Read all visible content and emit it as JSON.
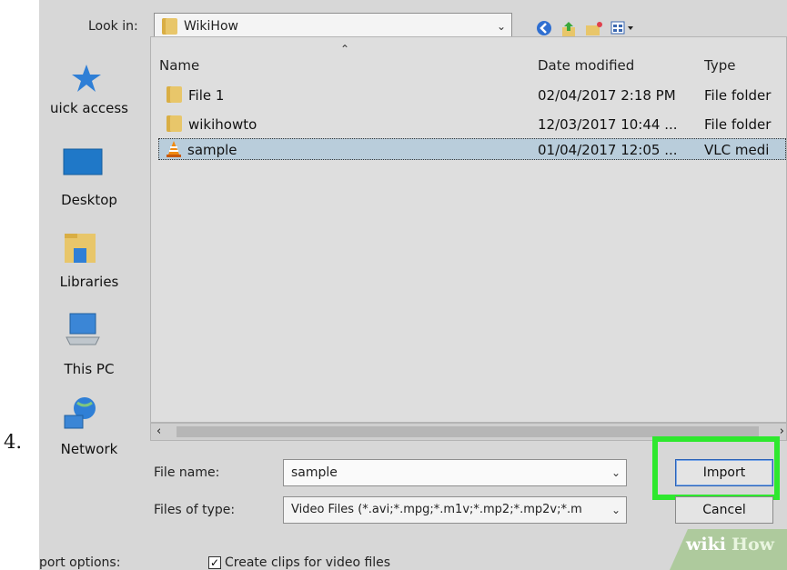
{
  "step_number": "4.",
  "toolbar": {
    "look_in_label": "Look in:",
    "look_in_value": "WikiHow",
    "icons": [
      "back-icon",
      "up-folder-icon",
      "new-folder-icon",
      "view-menu-icon"
    ]
  },
  "places": [
    {
      "label": "uick access",
      "icon": "star-icon"
    },
    {
      "label": "Desktop",
      "icon": "desktop-icon"
    },
    {
      "label": "Libraries",
      "icon": "libraries-icon"
    },
    {
      "label": "This PC",
      "icon": "computer-icon"
    },
    {
      "label": "Network",
      "icon": "network-icon"
    }
  ],
  "columns": {
    "name": "Name",
    "date": "Date modified",
    "type": "Type"
  },
  "files": [
    {
      "name": "File 1",
      "date": "02/04/2017 2:18 PM",
      "type": "File folder",
      "icon": "folder-icon",
      "selected": false
    },
    {
      "name": "wikihowto",
      "date": "12/03/2017 10:44 ...",
      "type": "File folder",
      "icon": "folder-icon",
      "selected": false
    },
    {
      "name": "sample",
      "date": "01/04/2017 12:05 ...",
      "type": "VLC medi",
      "icon": "vlc-cone-icon",
      "selected": true
    }
  ],
  "form": {
    "file_name_label": "File name:",
    "file_name_value": "sample",
    "file_type_label": "Files of type:",
    "file_type_value": "Video Files (*.avi;*.mpg;*.m1v;*.mp2;*.mp2v;*.m"
  },
  "buttons": {
    "import": "Import",
    "cancel": "Cancel"
  },
  "import_options": {
    "label": "port options:",
    "checkbox_label": "Create clips for video files",
    "checked": true
  },
  "watermark": {
    "wiki": "wiki",
    "how": "How"
  },
  "colors": {
    "highlight": "#2ee82e",
    "selection": "#b9cddb"
  }
}
